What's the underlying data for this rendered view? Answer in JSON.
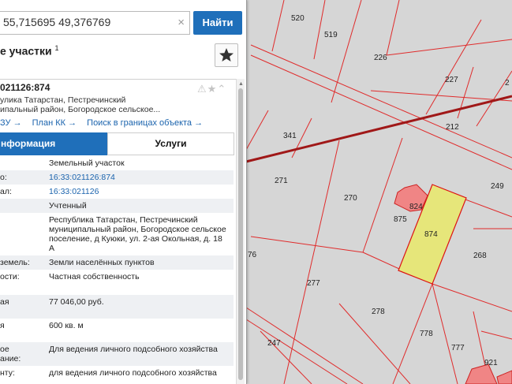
{
  "search": {
    "value": "55,715695 49,376769",
    "button": "Найти"
  },
  "panel": {
    "title": "е участки",
    "title_count": "1",
    "parcel": {
      "cadastral_number": "021126:874",
      "address_line1": "улика Татарстан, Пестречинский",
      "address_line2": "ипальный район, Богородское сельское..."
    },
    "links": [
      "ЗУ →",
      "План КК →",
      "Поиск в границах объекта →"
    ],
    "tabs": {
      "info": "нформация",
      "services": "Услуги"
    },
    "rows": [
      {
        "k": "",
        "v": "Земельный участок",
        "link": false
      },
      {
        "k": "о:",
        "v": "16:33:021126:874",
        "link": true
      },
      {
        "k": "ал:",
        "v": "16:33:021126",
        "link": true
      },
      {
        "k": "",
        "v": "Учтенный",
        "link": false
      },
      {
        "k": "",
        "v": "Республика Татарстан, Пестречинский муниципальный район, Богородское сельское поселение, д Куюки, ул. 2-ая Окольная, д. 18 А",
        "link": false
      },
      {
        "k": "земель:",
        "v": "Земли населённых пунктов",
        "link": false
      },
      {
        "k": "ости:",
        "v": "Частная собственность",
        "link": false
      },
      {
        "k": "ая",
        "v": "77 046,00 руб.",
        "link": false
      },
      {
        "k": "я",
        "v": "600 кв. м",
        "link": false
      },
      {
        "k": "ое\nание:",
        "v": "Для ведения личного подсобного хозяйства",
        "link": false
      },
      {
        "k": "нту:",
        "v": "для ведения личного подсобного хозяйства",
        "link": false
      }
    ]
  },
  "map": {
    "labels": [
      "520",
      "519",
      "226",
      "227",
      "2",
      "212",
      "341",
      "271",
      "270",
      "249",
      "824",
      "875",
      "874",
      "268",
      "76",
      "277",
      "278",
      "778",
      "777",
      "247",
      "921"
    ],
    "highlight_color": "#e6e67a",
    "building_color": "#f08585",
    "line_color": "#e02b2b",
    "road_color": "#a01818"
  }
}
